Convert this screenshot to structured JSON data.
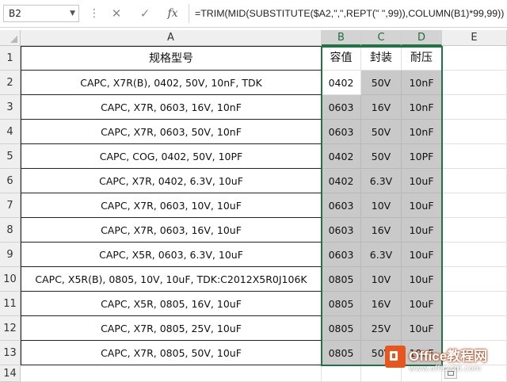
{
  "formula_bar": {
    "name_box": "B2",
    "formula": "=TRIM(MID(SUBSTITUTE($A2,\",\",REPT(\" \",99)),COLUMN(B1)*99,99))",
    "cancel_glyph": "✕",
    "confirm_glyph": "✓",
    "fx_label": "fx"
  },
  "columns": [
    "A",
    "B",
    "C",
    "D",
    "E"
  ],
  "rows": [
    "1",
    "2",
    "3",
    "4",
    "5",
    "6",
    "7",
    "8",
    "9",
    "10",
    "11",
    "12",
    "13",
    "14"
  ],
  "header_row": {
    "spec": "规格型号",
    "cap": "容值",
    "pkg": "封装",
    "volt": "耐压"
  },
  "data_rows": [
    {
      "spec": "CAPC, X7R(B), 0402, 50V, 10nF, TDK",
      "cap": "0402",
      "pkg": "50V",
      "volt": "10nF"
    },
    {
      "spec": "CAPC, X7R, 0603, 16V, 10nF",
      "cap": "0603",
      "pkg": "16V",
      "volt": "10nF"
    },
    {
      "spec": "CAPC, X7R, 0603, 50V, 10nF",
      "cap": "0603",
      "pkg": "50V",
      "volt": "10nF"
    },
    {
      "spec": "CAPC, COG, 0402, 50V, 10PF",
      "cap": "0402",
      "pkg": "50V",
      "volt": "10PF"
    },
    {
      "spec": "CAPC, X7R, 0402, 6.3V, 10uF",
      "cap": "0402",
      "pkg": "6.3V",
      "volt": "10uF"
    },
    {
      "spec": "CAPC, X7R, 0603, 10V, 10uF",
      "cap": "0603",
      "pkg": "10V",
      "volt": "10uF"
    },
    {
      "spec": "CAPC, X7R, 0603, 16V, 10uF",
      "cap": "0603",
      "pkg": "16V",
      "volt": "10uF"
    },
    {
      "spec": "CAPC, X5R, 0603, 6.3V, 10uF",
      "cap": "0603",
      "pkg": "6.3V",
      "volt": "10uF"
    },
    {
      "spec": "CAPC, X5R(B), 0805, 10V, 10uF, TDK:C2012X5R0J106K",
      "cap": "0805",
      "pkg": "10V",
      "volt": "10uF"
    },
    {
      "spec": "CAPC, X5R, 0805, 16V, 10uF",
      "cap": "0805",
      "pkg": "16V",
      "volt": "10uF"
    },
    {
      "spec": "CAPC, X7R, 0805, 25V, 10uF",
      "cap": "0805",
      "pkg": "25V",
      "volt": "10uF"
    },
    {
      "spec": "CAPC, X7R, 0805, 50V, 10uF",
      "cap": "0805",
      "pkg": "50V",
      "volt": "10uF"
    }
  ],
  "watermark": {
    "title": "Office教程网",
    "url": "www.office26.com"
  },
  "colors": {
    "selection_border": "#217346",
    "shaded_range": "#c9c9c9",
    "watermark_logo": "#e8561f"
  }
}
